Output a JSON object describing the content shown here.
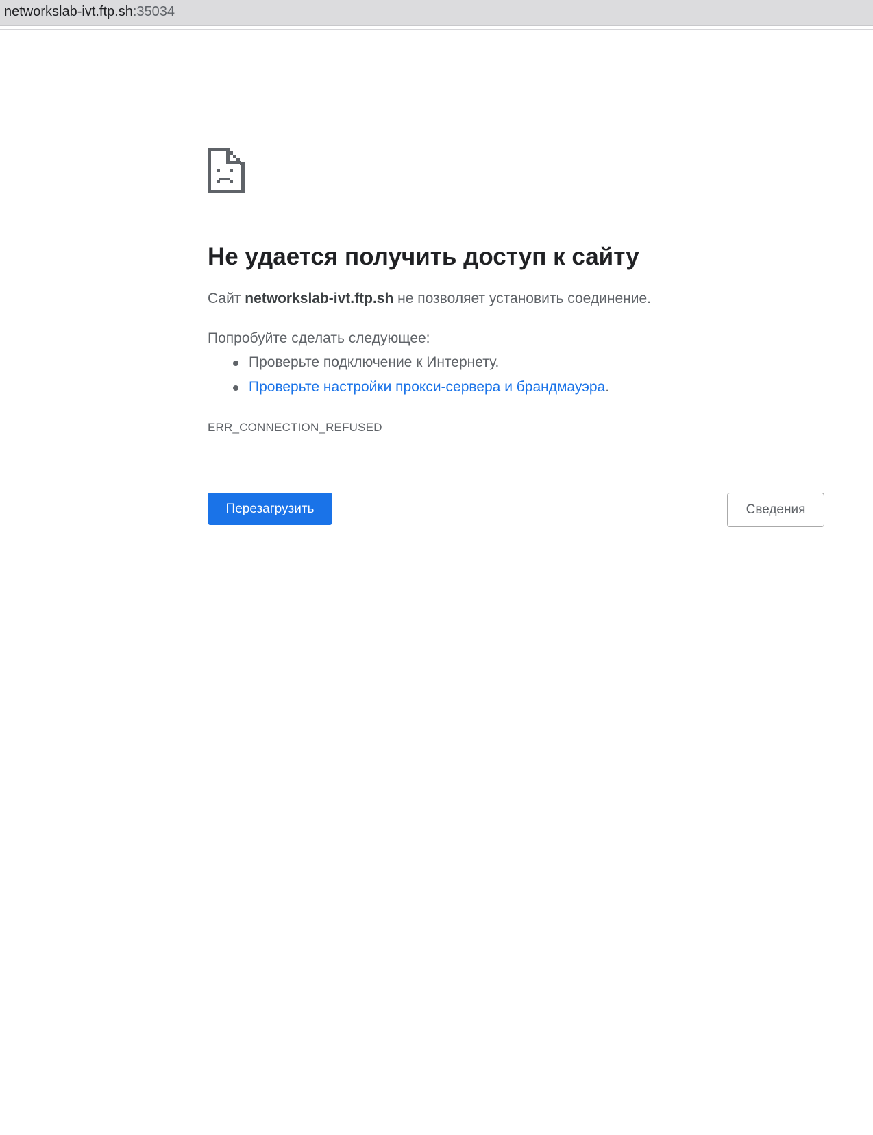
{
  "address_bar": {
    "host": "networkslab-ivt.ftp.sh",
    "port": ":35034"
  },
  "error_page": {
    "icon": "sad-document-icon",
    "heading": "Не удается получить доступ к сайту",
    "message_prefix": "Сайт ",
    "message_host": "networkslab-ivt.ftp.sh",
    "message_suffix": " не позволяет установить соединение.",
    "suggestions_title": "Попробуйте сделать следующее:",
    "suggestions": [
      {
        "text": "Проверьте подключение к Интернету.",
        "link": "",
        "after": ""
      },
      {
        "text": "",
        "link": "Проверьте настройки прокси-сервера и брандмауэра",
        "after": "."
      }
    ],
    "error_code": "ERR_CONNECTION_REFUSED",
    "reload_button": "Перезагрузить",
    "details_button": "Сведения"
  },
  "colors": {
    "accent": "#1a73e8",
    "text": "#5f6368",
    "heading": "#202124",
    "address_bar_bg": "#dcdcde"
  }
}
